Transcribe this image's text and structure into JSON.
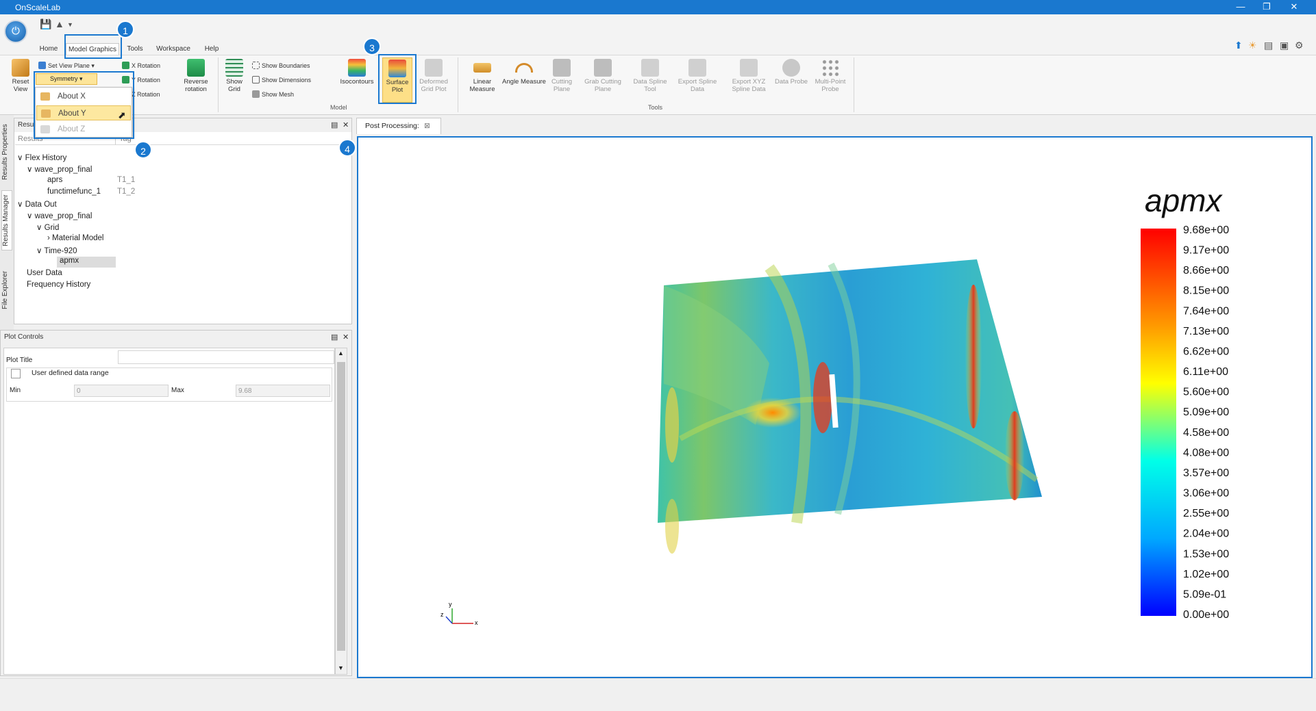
{
  "window": {
    "title": "OnScaleLab"
  },
  "tabs": [
    "Home",
    "Model Graphics",
    "Tools",
    "Workspace",
    "Help"
  ],
  "ribbon": {
    "reset_view": "Reset View",
    "set_view_plane": "Set View Plane",
    "symmetry": "Symmetry",
    "x_rotation": "X Rotation",
    "y_rotation": "Y Rotation",
    "z_rotation": "Z Rotation",
    "reverse_rotation": "Reverse rotation",
    "show_grid": "Show Grid",
    "show_boundaries": "Show Boundaries",
    "show_dimensions": "Show Dimensions",
    "show_mesh": "Show Mesh",
    "isocontours": "Isocontours",
    "surface_plot": "Surface Plot",
    "deformed_grid_plot": "Deformed Grid Plot",
    "model_group": "Model",
    "linear_measure": "Linear Measure",
    "angle_measure": "Angle Measure",
    "cutting_plane": "Cutting Plane",
    "grab_cutting_plane": "Grab Cutting Plane",
    "data_spline_tool": "Data Spline Tool",
    "export_spline_data": "Export Spline Data",
    "export_xyz_spline_data": "Export XYZ Spline Data",
    "data_probe": "Data Probe",
    "multi_point_probe": "Multi-Point Probe",
    "tools_group": "Tools"
  },
  "symmetry_menu": [
    "About X",
    "About Y",
    "About Z"
  ],
  "callouts": [
    "1",
    "2",
    "3",
    "4"
  ],
  "side_tabs": [
    "Results Properties",
    "Results Manager",
    "File Explorer"
  ],
  "results_panel": {
    "title": "Results",
    "col_results": "Results",
    "col_tag": "Tag",
    "tree": [
      {
        "label": "Flex History",
        "tag": ""
      },
      {
        "label": "wave_prop_final",
        "tag": ""
      },
      {
        "label": "aprs",
        "tag": "T1_1"
      },
      {
        "label": "functimefunc_1",
        "tag": "T1_2"
      },
      {
        "label": "Data Out",
        "tag": ""
      },
      {
        "label": "wave_prop_final",
        "tag": ""
      },
      {
        "label": "Grid",
        "tag": ""
      },
      {
        "label": "Material Model",
        "tag": ""
      },
      {
        "label": "Time-920",
        "tag": ""
      },
      {
        "label": "apmx",
        "tag": ""
      },
      {
        "label": "User Data",
        "tag": ""
      },
      {
        "label": "Frequency History",
        "tag": ""
      }
    ]
  },
  "plot_controls": {
    "title": "Plot Controls",
    "plot_title_label": "Plot Title",
    "plot_title_value": "",
    "user_defined_range": "User defined data range",
    "min_label": "Min",
    "min_value": "0",
    "max_label": "Max",
    "max_value": "9.68"
  },
  "document_tab": "Post Processing:",
  "legend": {
    "variable": "apmx",
    "ticks": [
      "9.68e+00",
      "9.17e+00",
      "8.66e+00",
      "8.15e+00",
      "7.64e+00",
      "7.13e+00",
      "6.62e+00",
      "6.11e+00",
      "5.60e+00",
      "5.09e+00",
      "4.58e+00",
      "4.08e+00",
      "3.57e+00",
      "3.06e+00",
      "2.55e+00",
      "2.04e+00",
      "1.53e+00",
      "1.02e+00",
      "5.09e-01",
      "0.00e+00"
    ]
  },
  "axes_triad": {
    "x": "x",
    "y": "y",
    "z": "z"
  }
}
